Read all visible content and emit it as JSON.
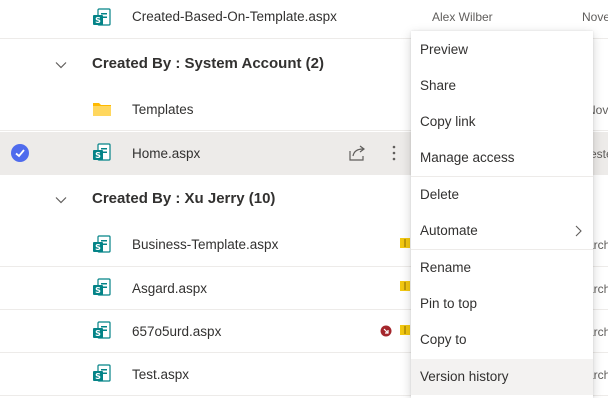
{
  "colors": {
    "accent": "#4f6bed",
    "sharepoint_green": "#038387",
    "folder_yellow": "#ffcf48",
    "selected_row": "#edebe9"
  },
  "rows": {
    "r1": {
      "name": "Created-Based-On-Template.aspx",
      "modified_by": "Alex Wilber",
      "modified": "Nove"
    },
    "r2": {
      "name": "Templates",
      "modified": "Nove"
    },
    "r3": {
      "name": "Home.aspx",
      "modified": "este"
    },
    "r4": {
      "name": "Business-Template.aspx",
      "modified": "arch"
    },
    "r5": {
      "name": "Asgard.aspx",
      "modified": "arch"
    },
    "r6": {
      "name": "657o5urd.aspx",
      "modified": "arch"
    },
    "r7": {
      "name": "Test.aspx",
      "modified": "arch"
    }
  },
  "groups": {
    "system": "Created By : System Account (2)",
    "xu": "Created By : Xu Jerry (10)"
  },
  "menu": {
    "preview": "Preview",
    "share": "Share",
    "copy_link": "Copy link",
    "manage_access": "Manage access",
    "delete": "Delete",
    "automate": "Automate",
    "rename": "Rename",
    "pin_to_top": "Pin to top",
    "copy_to": "Copy to",
    "version_history": "Version history"
  },
  "icons": {
    "file": "sharepoint-page-icon",
    "folder": "folder-icon",
    "check": "checkmark-circle-icon",
    "share": "share-icon",
    "more": "more-vertical-icon",
    "template_badge": "template-book-icon",
    "checkout_badge": "checked-out-icon"
  }
}
